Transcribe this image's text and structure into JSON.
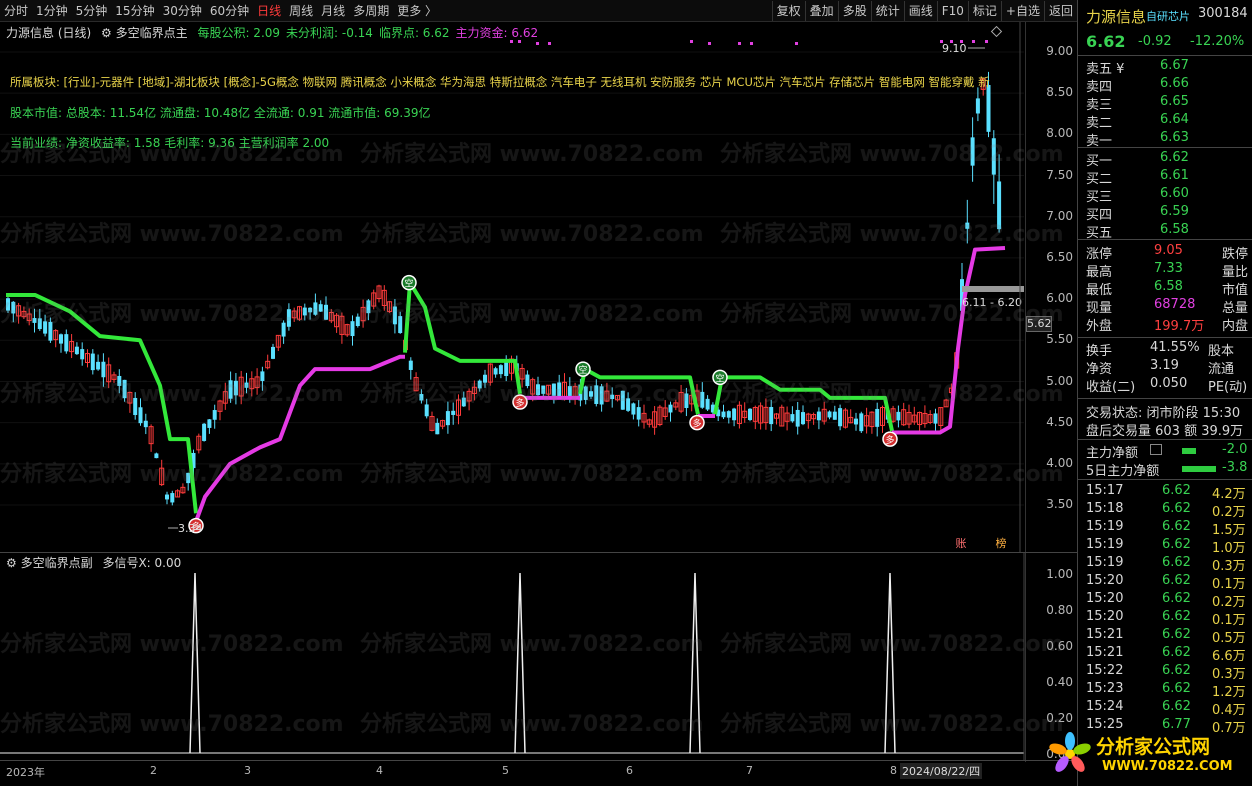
{
  "toolbar": {
    "periods": [
      "分时",
      "1分钟",
      "5分钟",
      "15分钟",
      "30分钟",
      "60分钟",
      "日线",
      "周线",
      "月线",
      "多周期",
      "更多 〉"
    ],
    "active_index": 6,
    "tools": [
      "复权",
      "叠加",
      "多股",
      "统计",
      "画线",
      "F10",
      "标记",
      "+自选",
      "返回"
    ]
  },
  "main": {
    "title": "力源信息 (日线)",
    "indicator_name": "多空临界点主",
    "indicator_values": [
      {
        "label": "每股公积: 2.09",
        "color": "#39d353"
      },
      {
        "label": "未分利润: -0.14",
        "color": "#39d353"
      },
      {
        "label": "临界点: 6.62",
        "color": "#39d353"
      },
      {
        "label": "主力资金: 6.62",
        "color": "#e040e0"
      }
    ],
    "sector_line": "所属板块: [行业]-元器件 [地域]-湖北板块 [概念]-5G概念 物联网 腾讯概念 小米概念 华为海思 特斯拉概念 汽车电子 无线耳机 安防服务 芯片 MCU芯片 汽车芯片 存储芯片 智能电网 智能穿戴 新",
    "cap_line": "股本市值: 总股本: 11.54亿 流通盘: 10.48亿 全流通: 0.91 流通市值: 69.39亿",
    "perf_line": "当前业绩:  净资收益率: 1.58 毛利率: 9.36 主营利润率 2.00",
    "y_labels": [
      "9.00",
      "8.50",
      "8.00",
      "7.50",
      "7.00",
      "6.50",
      "6.00",
      "5.50",
      "5.00",
      "4.50",
      "4.00",
      "3.50"
    ],
    "price_tag": "5.62",
    "high_annot": "9.10",
    "low_annot": "3.34",
    "range_annot": "6.11 - 6.20",
    "badges": {
      "sell": "空",
      "buy": "多"
    },
    "corner_badges": [
      "账",
      "榜"
    ]
  },
  "sub": {
    "title": "多空临界点副",
    "value_label": "多信号X: 0.00",
    "y_labels": [
      "1.00",
      "0.80",
      "0.60",
      "0.40",
      "0.20",
      "0.00"
    ]
  },
  "xaxis": {
    "labels": [
      "2023年",
      "2",
      "3",
      "4",
      "5",
      "6",
      "7",
      "8"
    ],
    "date_tag": "2024/08/22/四"
  },
  "watermark": "分析家公式网 www.70822.com",
  "right": {
    "name": "力源信息",
    "tag": "自研芯片",
    "code": "300184",
    "price": "6.62",
    "change": "-0.92",
    "change_pct": "-12.20%",
    "asks": [
      {
        "label": "卖五 ¥",
        "price": "6.67"
      },
      {
        "label": "卖四",
        "price": "6.66"
      },
      {
        "label": "卖三",
        "price": "6.65"
      },
      {
        "label": "卖二",
        "price": "6.64"
      },
      {
        "label": "卖一",
        "price": "6.63"
      }
    ],
    "bids": [
      {
        "label": "买一",
        "price": "6.62"
      },
      {
        "label": "买二",
        "price": "6.61"
      },
      {
        "label": "买三",
        "price": "6.60"
      },
      {
        "label": "买四",
        "price": "6.59"
      },
      {
        "label": "买五",
        "price": "6.58"
      }
    ],
    "stats": [
      {
        "l1": "涨停",
        "v1": "9.05",
        "c1": "#ff4040",
        "l2": "跌停"
      },
      {
        "l1": "最高",
        "v1": "7.33",
        "c1": "#39d353",
        "l2": "量比"
      },
      {
        "l1": "最低",
        "v1": "6.58",
        "c1": "#39d353",
        "l2": "市值"
      },
      {
        "l1": "现量",
        "v1": "68728",
        "c1": "#e040e0",
        "l2": "总量"
      },
      {
        "l1": "外盘",
        "v1": "199.7万",
        "c1": "#ff4040",
        "l2": "内盘"
      }
    ],
    "stats2": [
      {
        "l1": "换手",
        "v1": "41.55%",
        "l2": "股本"
      },
      {
        "l1": "净资",
        "v1": "3.19",
        "l2": "流通"
      },
      {
        "l1": "收益(二)",
        "v1": "0.050",
        "l2": "PE(动)"
      }
    ],
    "trade_status": "交易状态: 闭市阶段 15:30",
    "after_hours": "盘后交易量 603 额 39.9万",
    "main_net": {
      "label": "主力净额",
      "value": "-2.0"
    },
    "main_net5": {
      "label": "5日主力净额",
      "value": "-3.8"
    },
    "ticks": [
      {
        "t": "15:17",
        "p": "6.62",
        "v": "4.2万"
      },
      {
        "t": "15:18",
        "p": "6.62",
        "v": "0.2万"
      },
      {
        "t": "15:19",
        "p": "6.62",
        "v": "1.5万"
      },
      {
        "t": "15:19",
        "p": "6.62",
        "v": "1.0万"
      },
      {
        "t": "15:19",
        "p": "6.62",
        "v": "0.3万"
      },
      {
        "t": "15:20",
        "p": "6.62",
        "v": "0.1万"
      },
      {
        "t": "15:20",
        "p": "6.62",
        "v": "0.2万"
      },
      {
        "t": "15:20",
        "p": "6.62",
        "v": "0.1万"
      },
      {
        "t": "15:21",
        "p": "6.62",
        "v": "0.5万"
      },
      {
        "t": "15:21",
        "p": "6.62",
        "v": "6.6万"
      },
      {
        "t": "15:22",
        "p": "6.62",
        "v": "0.3万"
      },
      {
        "t": "15:23",
        "p": "6.62",
        "v": "1.2万"
      },
      {
        "t": "15:24",
        "p": "6.62",
        "v": "0.4万"
      },
      {
        "t": "15:25",
        "p": "6.77",
        "v": "0.7万"
      }
    ],
    "logo_text": "分析家公式网",
    "logo_url": "WWW.70822.COM"
  }
}
